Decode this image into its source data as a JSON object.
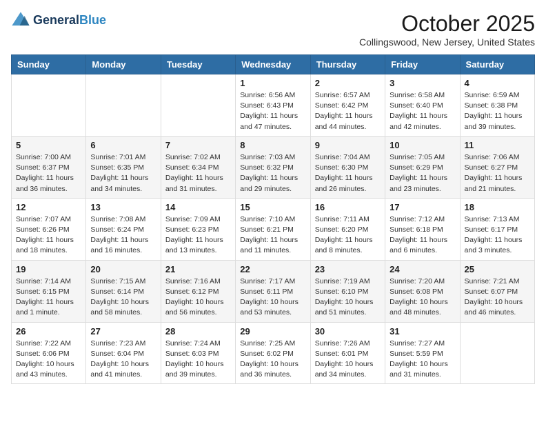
{
  "header": {
    "logo_line1": "General",
    "logo_line2": "Blue",
    "month": "October 2025",
    "location": "Collingswood, New Jersey, United States"
  },
  "weekdays": [
    "Sunday",
    "Monday",
    "Tuesday",
    "Wednesday",
    "Thursday",
    "Friday",
    "Saturday"
  ],
  "weeks": [
    [
      {
        "day": "",
        "info": ""
      },
      {
        "day": "",
        "info": ""
      },
      {
        "day": "",
        "info": ""
      },
      {
        "day": "1",
        "info": "Sunrise: 6:56 AM\nSunset: 6:43 PM\nDaylight: 11 hours and 47 minutes."
      },
      {
        "day": "2",
        "info": "Sunrise: 6:57 AM\nSunset: 6:42 PM\nDaylight: 11 hours and 44 minutes."
      },
      {
        "day": "3",
        "info": "Sunrise: 6:58 AM\nSunset: 6:40 PM\nDaylight: 11 hours and 42 minutes."
      },
      {
        "day": "4",
        "info": "Sunrise: 6:59 AM\nSunset: 6:38 PM\nDaylight: 11 hours and 39 minutes."
      }
    ],
    [
      {
        "day": "5",
        "info": "Sunrise: 7:00 AM\nSunset: 6:37 PM\nDaylight: 11 hours and 36 minutes."
      },
      {
        "day": "6",
        "info": "Sunrise: 7:01 AM\nSunset: 6:35 PM\nDaylight: 11 hours and 34 minutes."
      },
      {
        "day": "7",
        "info": "Sunrise: 7:02 AM\nSunset: 6:34 PM\nDaylight: 11 hours and 31 minutes."
      },
      {
        "day": "8",
        "info": "Sunrise: 7:03 AM\nSunset: 6:32 PM\nDaylight: 11 hours and 29 minutes."
      },
      {
        "day": "9",
        "info": "Sunrise: 7:04 AM\nSunset: 6:30 PM\nDaylight: 11 hours and 26 minutes."
      },
      {
        "day": "10",
        "info": "Sunrise: 7:05 AM\nSunset: 6:29 PM\nDaylight: 11 hours and 23 minutes."
      },
      {
        "day": "11",
        "info": "Sunrise: 7:06 AM\nSunset: 6:27 PM\nDaylight: 11 hours and 21 minutes."
      }
    ],
    [
      {
        "day": "12",
        "info": "Sunrise: 7:07 AM\nSunset: 6:26 PM\nDaylight: 11 hours and 18 minutes."
      },
      {
        "day": "13",
        "info": "Sunrise: 7:08 AM\nSunset: 6:24 PM\nDaylight: 11 hours and 16 minutes."
      },
      {
        "day": "14",
        "info": "Sunrise: 7:09 AM\nSunset: 6:23 PM\nDaylight: 11 hours and 13 minutes."
      },
      {
        "day": "15",
        "info": "Sunrise: 7:10 AM\nSunset: 6:21 PM\nDaylight: 11 hours and 11 minutes."
      },
      {
        "day": "16",
        "info": "Sunrise: 7:11 AM\nSunset: 6:20 PM\nDaylight: 11 hours and 8 minutes."
      },
      {
        "day": "17",
        "info": "Sunrise: 7:12 AM\nSunset: 6:18 PM\nDaylight: 11 hours and 6 minutes."
      },
      {
        "day": "18",
        "info": "Sunrise: 7:13 AM\nSunset: 6:17 PM\nDaylight: 11 hours and 3 minutes."
      }
    ],
    [
      {
        "day": "19",
        "info": "Sunrise: 7:14 AM\nSunset: 6:15 PM\nDaylight: 11 hours and 1 minute."
      },
      {
        "day": "20",
        "info": "Sunrise: 7:15 AM\nSunset: 6:14 PM\nDaylight: 10 hours and 58 minutes."
      },
      {
        "day": "21",
        "info": "Sunrise: 7:16 AM\nSunset: 6:12 PM\nDaylight: 10 hours and 56 minutes."
      },
      {
        "day": "22",
        "info": "Sunrise: 7:17 AM\nSunset: 6:11 PM\nDaylight: 10 hours and 53 minutes."
      },
      {
        "day": "23",
        "info": "Sunrise: 7:19 AM\nSunset: 6:10 PM\nDaylight: 10 hours and 51 minutes."
      },
      {
        "day": "24",
        "info": "Sunrise: 7:20 AM\nSunset: 6:08 PM\nDaylight: 10 hours and 48 minutes."
      },
      {
        "day": "25",
        "info": "Sunrise: 7:21 AM\nSunset: 6:07 PM\nDaylight: 10 hours and 46 minutes."
      }
    ],
    [
      {
        "day": "26",
        "info": "Sunrise: 7:22 AM\nSunset: 6:06 PM\nDaylight: 10 hours and 43 minutes."
      },
      {
        "day": "27",
        "info": "Sunrise: 7:23 AM\nSunset: 6:04 PM\nDaylight: 10 hours and 41 minutes."
      },
      {
        "day": "28",
        "info": "Sunrise: 7:24 AM\nSunset: 6:03 PM\nDaylight: 10 hours and 39 minutes."
      },
      {
        "day": "29",
        "info": "Sunrise: 7:25 AM\nSunset: 6:02 PM\nDaylight: 10 hours and 36 minutes."
      },
      {
        "day": "30",
        "info": "Sunrise: 7:26 AM\nSunset: 6:01 PM\nDaylight: 10 hours and 34 minutes."
      },
      {
        "day": "31",
        "info": "Sunrise: 7:27 AM\nSunset: 5:59 PM\nDaylight: 10 hours and 31 minutes."
      },
      {
        "day": "",
        "info": ""
      }
    ]
  ]
}
